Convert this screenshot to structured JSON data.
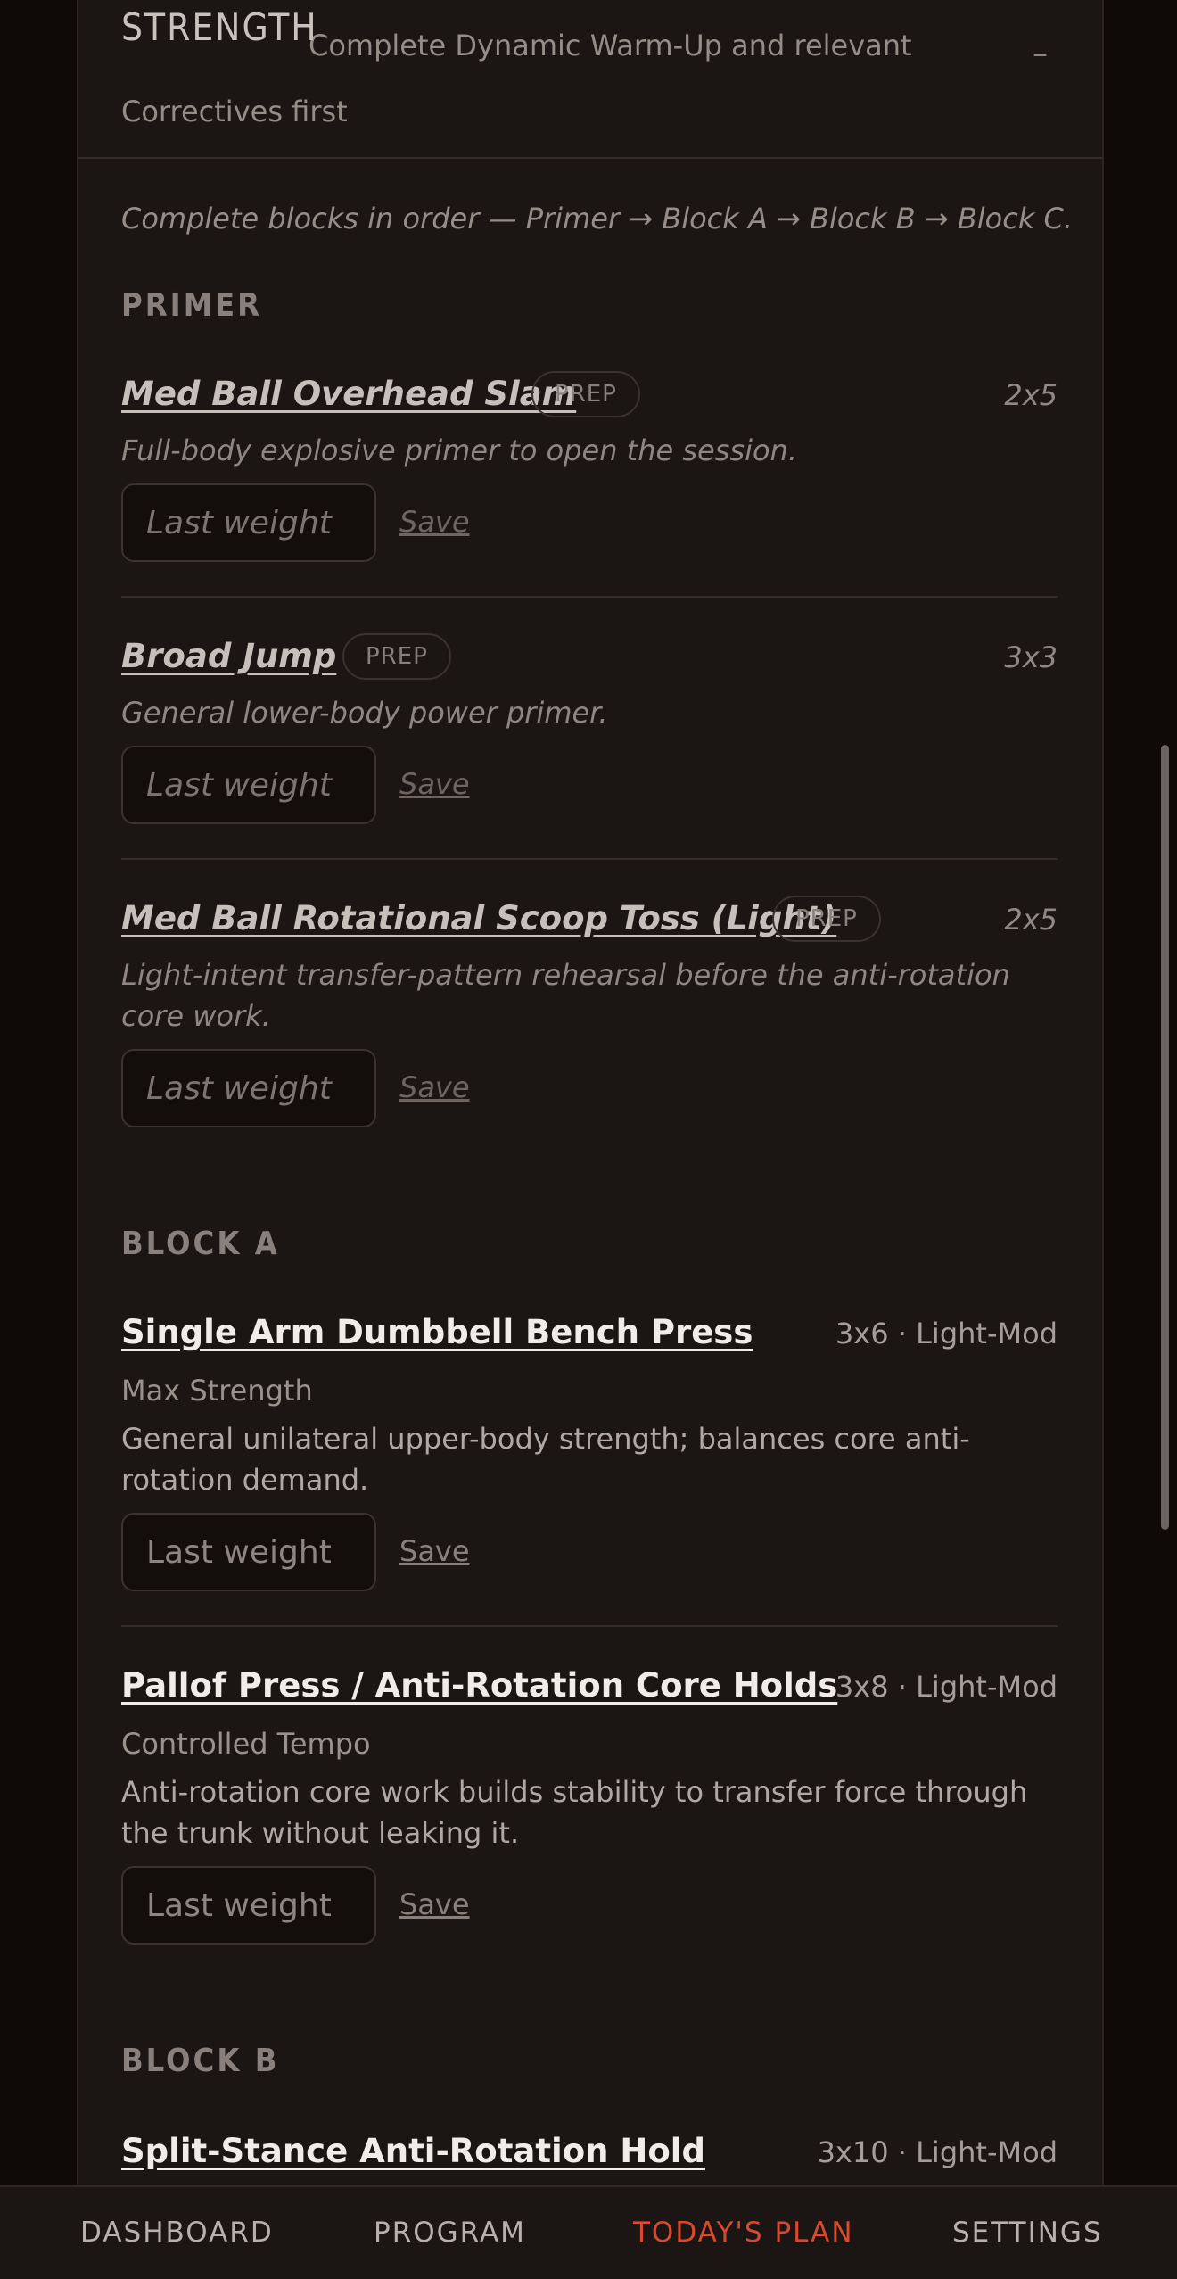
{
  "section": {
    "title": "STRENGTH",
    "subtitle": "Complete Dynamic Warm-Up and relevant Correctives first",
    "collapse_glyph": "–"
  },
  "intro": "Complete blocks in order — Primer → Block A → Block B → Block C.",
  "weight_placeholder": "Last weight",
  "save_label": "Save",
  "blocks": {
    "primer": {
      "title": "PRIMER",
      "exercises": [
        {
          "name": "Med Ball Overhead Slam",
          "badge": "PREP",
          "sets": "2x5",
          "desc": "Full-body explosive primer to open the session."
        },
        {
          "name": "Broad Jump",
          "badge": "PREP",
          "sets": "3x3",
          "desc": "General lower-body power primer."
        },
        {
          "name": "Med Ball Rotational Scoop Toss (Light)",
          "badge": "PREP",
          "sets": "2x5",
          "desc": "Light-intent transfer-pattern rehearsal before the anti-rotation core work."
        }
      ]
    },
    "a": {
      "title": "BLOCK A",
      "exercises": [
        {
          "name": "Single Arm Dumbbell Bench Press",
          "sets": "3x6 · Light-Mod",
          "focus": "Max Strength",
          "desc": "General unilateral upper-body strength; balances core anti-rotation demand."
        },
        {
          "name": "Pallof Press / Anti-Rotation Core Holds",
          "sets": "3x8 · Light-Mod",
          "focus": "Controlled Tempo",
          "desc": "Anti-rotation core work builds stability to transfer force through the trunk without leaking it."
        }
      ]
    },
    "b": {
      "title": "BLOCK B",
      "exercises": [
        {
          "name": "Split-Stance Anti-Rotation Hold",
          "sets": "3x10 · Light-Mod"
        }
      ]
    }
  },
  "nav": {
    "items": [
      "DASHBOARD",
      "PROGRAM",
      "TODAY'S PLAN",
      "SETTINGS"
    ],
    "active": "TODAY'S PLAN",
    "active_color": "#d8492d"
  }
}
